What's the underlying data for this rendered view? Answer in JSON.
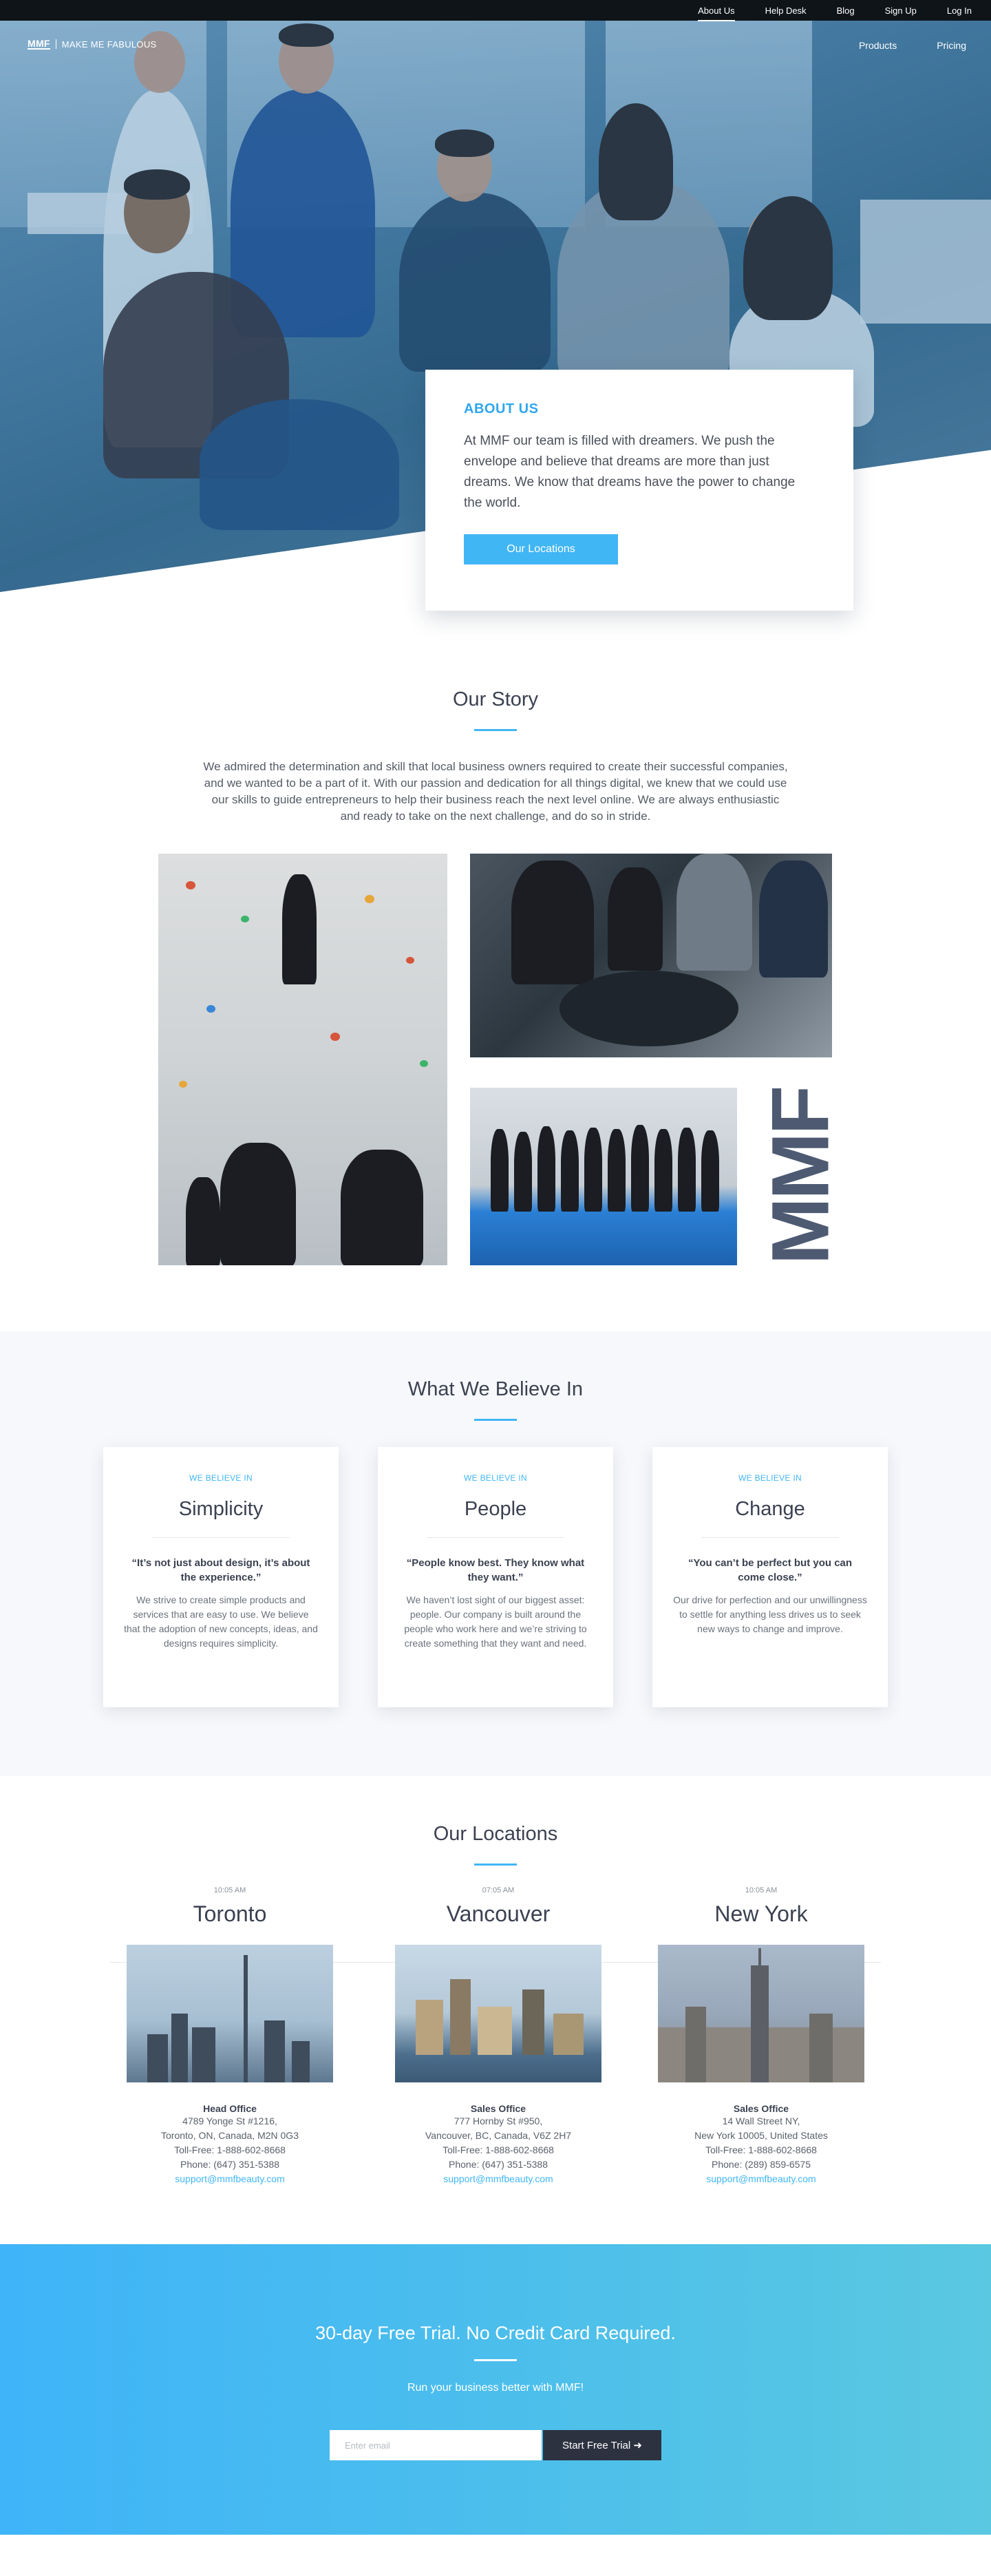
{
  "topnav": {
    "items": [
      {
        "label": "About Us",
        "active": true
      },
      {
        "label": "Help Desk"
      },
      {
        "label": "Blog"
      },
      {
        "label": "Sign Up"
      },
      {
        "label": "Log In"
      }
    ]
  },
  "header": {
    "logo_mark": "MMF",
    "logo_text": "MAKE ME FABULOUS",
    "nav": [
      "Products",
      "Pricing"
    ]
  },
  "hero": {
    "kicker": "ABOUT US",
    "body": "At MMF our team is filled with dreamers. We push the envelope and believe that dreams are more than just dreams. We know that dreams have the power to change the world.",
    "button": "Our Locations"
  },
  "story": {
    "title": "Our Story",
    "body": "We admired the determination and skill that local business owners required to create their successful companies, and we wanted to be a part of it. With our passion and dedication for all things digital, we knew that we could use our skills to guide entrepreneurs to help their business reach the next level online. We are always enthusiastic and ready to take on the next challenge, and do so in stride.",
    "brand_text": "MMF"
  },
  "believe": {
    "title": "What We Believe In",
    "cards": [
      {
        "kicker": "WE BELIEVE IN",
        "title": "Simplicity",
        "quote": "“It’s not just about design, it’s about the experience.”",
        "desc": "We strive to create simple products and services that are easy to use. We believe that the adoption of new concepts, ideas, and designs requires simplicity."
      },
      {
        "kicker": "WE BELIEVE IN",
        "title": "People",
        "quote": "“People know best. They know what they want.”",
        "desc": "We haven’t lost sight of our biggest asset: people. Our company is built around the people who work here and we’re striving to create something that they want and need."
      },
      {
        "kicker": "WE BELIEVE IN",
        "title": "Change",
        "quote": "“You can’t be perfect but you can come close.”",
        "desc": "Our drive for perfection and our unwillingness to settle for anything less drives us to seek new ways to change and improve."
      }
    ]
  },
  "locations": {
    "title": "Our Locations",
    "items": [
      {
        "time": "10:05 AM",
        "city": "Toronto",
        "office": "Head Office",
        "address1": "4789 Yonge St #1216,",
        "address2": "Toronto, ON, Canada, M2N 0G3",
        "tollfree": "Toll-Free: 1-888-602-8668",
        "phone": "Phone: (647) 351-5388",
        "email": "support@mmfbeauty.com"
      },
      {
        "time": "07:05 AM",
        "city": "Vancouver",
        "office": "Sales Office",
        "address1": "777 Hornby St #950,",
        "address2": "Vancouver, BC, Canada, V6Z 2H7",
        "tollfree": "Toll-Free: 1-888-602-8668",
        "phone": "Phone: (647) 351-5388",
        "email": "support@mmfbeauty.com"
      },
      {
        "time": "10:05 AM",
        "city": "New York",
        "office": "Sales Office",
        "address1": "14 Wall Street NY,",
        "address2": "New York 10005, United States",
        "tollfree": "Toll-Free: 1-888-602-8668",
        "phone": "Phone: (289) 859-6575",
        "email": "support@mmfbeauty.com"
      }
    ]
  },
  "cta": {
    "title": "30-day Free Trial. No Credit Card Required.",
    "subtitle": "Run your business better with MMF!",
    "email_placeholder": "Enter email",
    "button": "Start Free Trial",
    "arrow_icon": "arrow-right-icon"
  },
  "colors": {
    "accent": "#41b6f5",
    "dark": "#0f1418",
    "text": "#3b4150"
  }
}
